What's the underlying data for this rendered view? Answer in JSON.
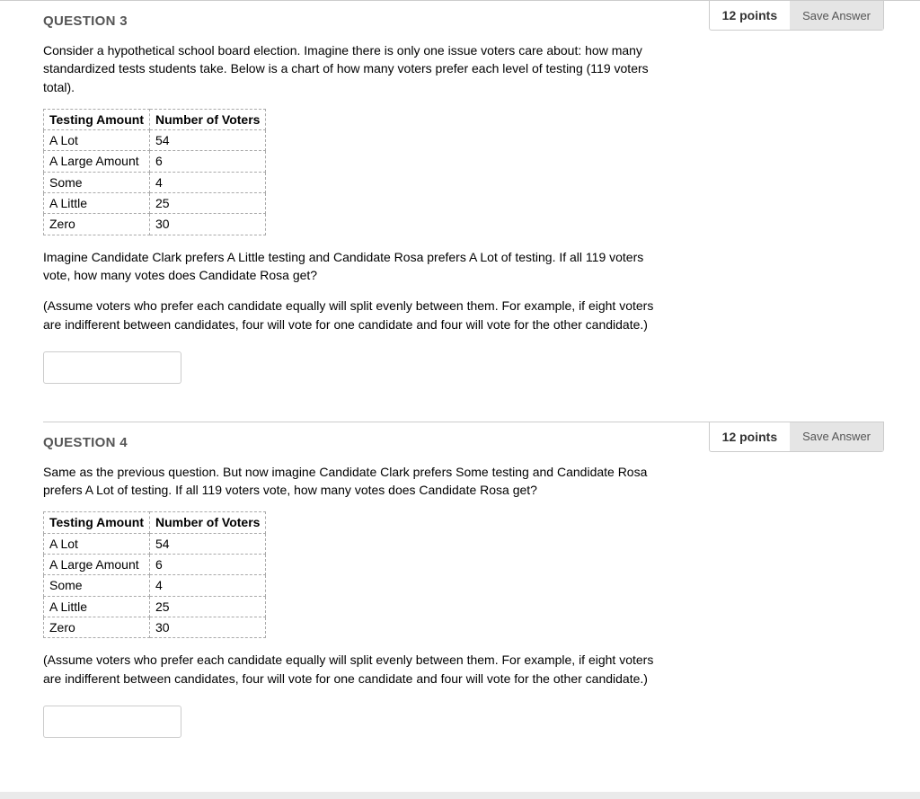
{
  "questions": [
    {
      "title": "QUESTION 3",
      "points_label": "12 points",
      "save_label": "Save Answer",
      "para1": "Consider a hypothetical school board election. Imagine there is only one issue voters care about: how many standardized tests students take. Below is a chart of how many voters prefer each level of testing (119 voters total).",
      "table": {
        "headers": [
          "Testing Amount",
          "Number of Voters"
        ],
        "rows": [
          [
            "A Lot",
            "54"
          ],
          [
            "A Large Amount",
            "6"
          ],
          [
            "Some",
            "4"
          ],
          [
            "A Little",
            "25"
          ],
          [
            "Zero",
            "30"
          ]
        ]
      },
      "para2": "Imagine Candidate Clark prefers A Little testing and Candidate Rosa prefers A Lot of testing. If all 119 voters vote, how many votes does Candidate Rosa get?",
      "para3": "(Assume voters who prefer each candidate equally will split evenly between them. For example, if eight voters are indifferent between candidates, four will vote for one candidate and four will vote for the other candidate.)"
    },
    {
      "title": "QUESTION 4",
      "points_label": "12 points",
      "save_label": "Save Answer",
      "para1": "Same as the previous question. But now imagine Candidate Clark prefers Some testing and Candidate Rosa prefers A Lot of testing. If all 119 voters vote, how many votes does Candidate Rosa get?",
      "table": {
        "headers": [
          "Testing Amount",
          "Number of Voters"
        ],
        "rows": [
          [
            "A Lot",
            "54"
          ],
          [
            "A Large Amount",
            "6"
          ],
          [
            "Some",
            "4"
          ],
          [
            "A Little",
            "25"
          ],
          [
            "Zero",
            "30"
          ]
        ]
      },
      "para3": "(Assume voters who prefer each candidate equally will split evenly between them. For example, if eight voters are indifferent between candidates, four will vote for one candidate and four will vote for the other candidate.)"
    }
  ]
}
